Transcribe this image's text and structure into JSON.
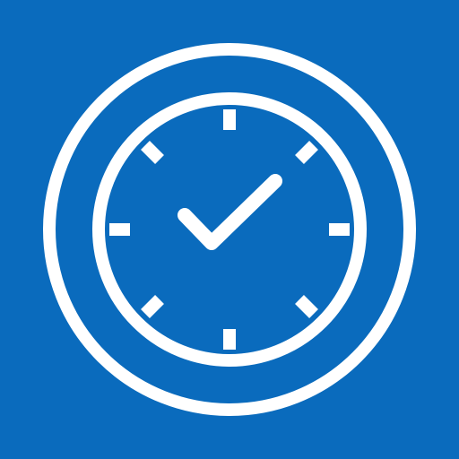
{
  "icon": {
    "name": "clock-check-icon",
    "background_color": "#0a6bbd",
    "foreground_color": "#ffffff",
    "elements": [
      "outer-ring",
      "clock-face",
      "hour-ticks",
      "checkmark"
    ],
    "tick_count": 8
  }
}
